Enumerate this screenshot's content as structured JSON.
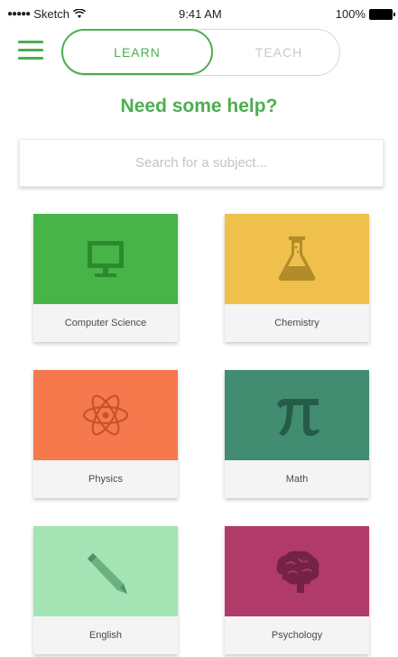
{
  "status_bar": {
    "carrier": "Sketch",
    "time": "9:41 AM",
    "battery": "100%"
  },
  "header": {
    "learn_tab": "LEARN",
    "teach_tab": "TEACH",
    "active_tab": "LEARN"
  },
  "title": "Need some help?",
  "search": {
    "placeholder": "Search for a subject..."
  },
  "subjects": [
    {
      "label": "Computer Science",
      "color": "#46b446",
      "icon": "monitor-icon"
    },
    {
      "label": "Chemistry",
      "color": "#f0c04c",
      "icon": "flask-icon"
    },
    {
      "label": "Physics",
      "color": "#f5794d",
      "icon": "atom-icon"
    },
    {
      "label": "Math",
      "color": "#428c71",
      "icon": "pi-icon"
    },
    {
      "label": "English",
      "color": "#a3e3b4",
      "icon": "pencil-icon"
    },
    {
      "label": "Psychology",
      "color": "#b03b69",
      "icon": "brain-icon"
    }
  ],
  "colors": {
    "accent": "#4cae4f",
    "inactive": "#c9c9c9"
  }
}
